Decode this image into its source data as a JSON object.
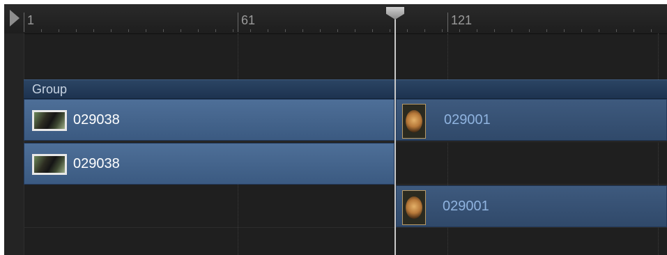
{
  "ruler": {
    "labels": [
      "1",
      "61",
      "121"
    ]
  },
  "group": {
    "label": "Group"
  },
  "clips": [
    {
      "label": "029038"
    },
    {
      "label": "029001"
    },
    {
      "label": "029038"
    },
    {
      "label": "029001"
    }
  ],
  "colors": {
    "clip": "#4e6f98",
    "clip_dim_text": "#8fb3df",
    "group_bar": "#2b4463",
    "background": "#1f1f1f"
  },
  "icons": {
    "play_marker": "play-range-start-icon",
    "playhead": "playhead-icon",
    "thumb_wide": "video-thumbnail-icon",
    "thumb_tall": "image-thumbnail-icon"
  }
}
